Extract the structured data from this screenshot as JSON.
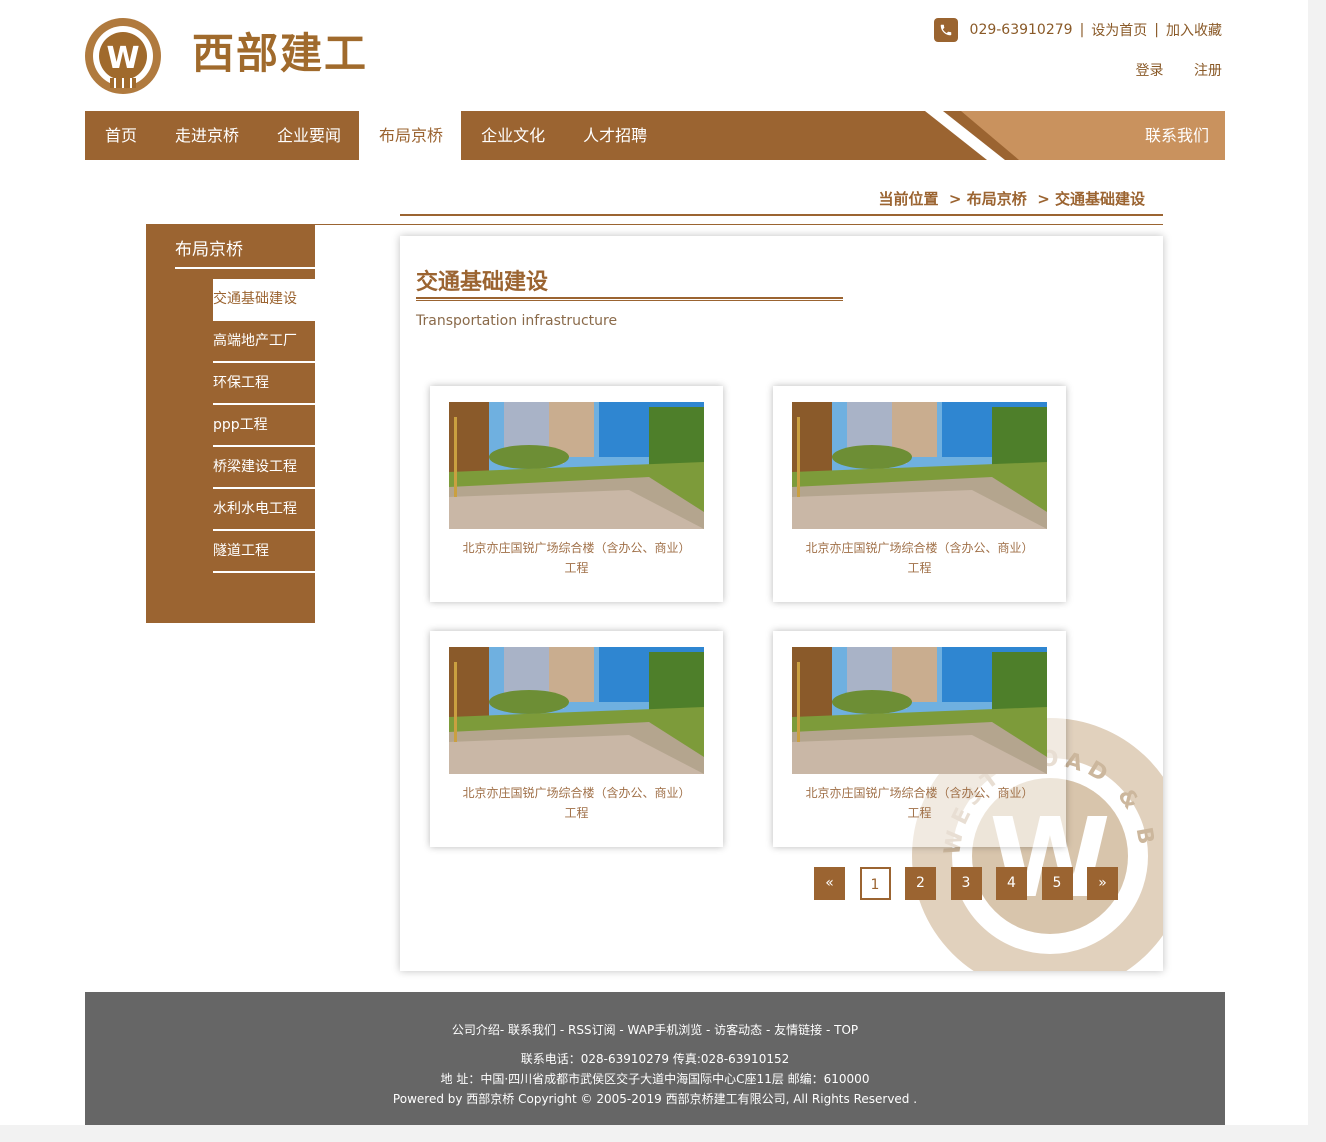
{
  "brand": {
    "name": "西部建工",
    "seal_text": "WEST ROAD & BRIDGE CONSTRUCTION"
  },
  "topbar": {
    "phone": "029-63910279",
    "set_home": "设为首页",
    "add_fav": "加入收藏",
    "login": "登录",
    "register": "注册"
  },
  "nav": {
    "items": [
      {
        "label": "首页"
      },
      {
        "label": "走进京桥"
      },
      {
        "label": "企业要闻"
      },
      {
        "label": "布局京桥"
      },
      {
        "label": "企业文化"
      },
      {
        "label": "人才招聘"
      }
    ],
    "active_index": 3,
    "contact": "联系我们"
  },
  "breadcrumb": {
    "prefix": "当前位置",
    "level1": "布局京桥",
    "level2": "交通基础建设"
  },
  "sidebar": {
    "title": "布局京桥",
    "items": [
      {
        "label": "交通基础建设"
      },
      {
        "label": "高端地产工厂"
      },
      {
        "label": "环保工程"
      },
      {
        "label": "ppp工程"
      },
      {
        "label": "桥梁建设工程"
      },
      {
        "label": "水利水电工程"
      },
      {
        "label": "隧道工程"
      }
    ],
    "active_index": 0
  },
  "main": {
    "title": "交通基础建设",
    "subtitle": "Transportation infrastructure",
    "cards": [
      {
        "caption_line1": "北京亦庄国锐广场综合楼（含办公、商业）",
        "caption_line2": "工程"
      },
      {
        "caption_line1": "北京亦庄国锐广场综合楼（含办公、商业）",
        "caption_line2": "工程"
      },
      {
        "caption_line1": "北京亦庄国锐广场综合楼（含办公、商业）",
        "caption_line2": "工程"
      },
      {
        "caption_line1": "北京亦庄国锐广场综合楼（含办公、商业）",
        "caption_line2": "工程"
      }
    ]
  },
  "pagination": {
    "prev": "«",
    "pages": [
      "1",
      "2",
      "3",
      "4",
      "5"
    ],
    "current": "1",
    "next": "»"
  },
  "footer": {
    "links": [
      "公司介绍",
      "联系我们",
      "RSS订阅",
      "WAP手机浏览",
      "访客动态",
      "友情链接",
      "TOP"
    ],
    "contact": "联系电话：028-63910279 传真:028-63910152",
    "address": "地 址：中国·四川省成都市武侯区交子大道中海国际中心C座11层 邮编：610000",
    "copyright": "Powered by 西部京桥 Copyright © 2005-2019 西部京桥建工有限公司, All Rights Reserved ."
  },
  "colors": {
    "accent": "#9b6431",
    "accent_light": "#c9925e",
    "footer_bg": "#666666"
  }
}
